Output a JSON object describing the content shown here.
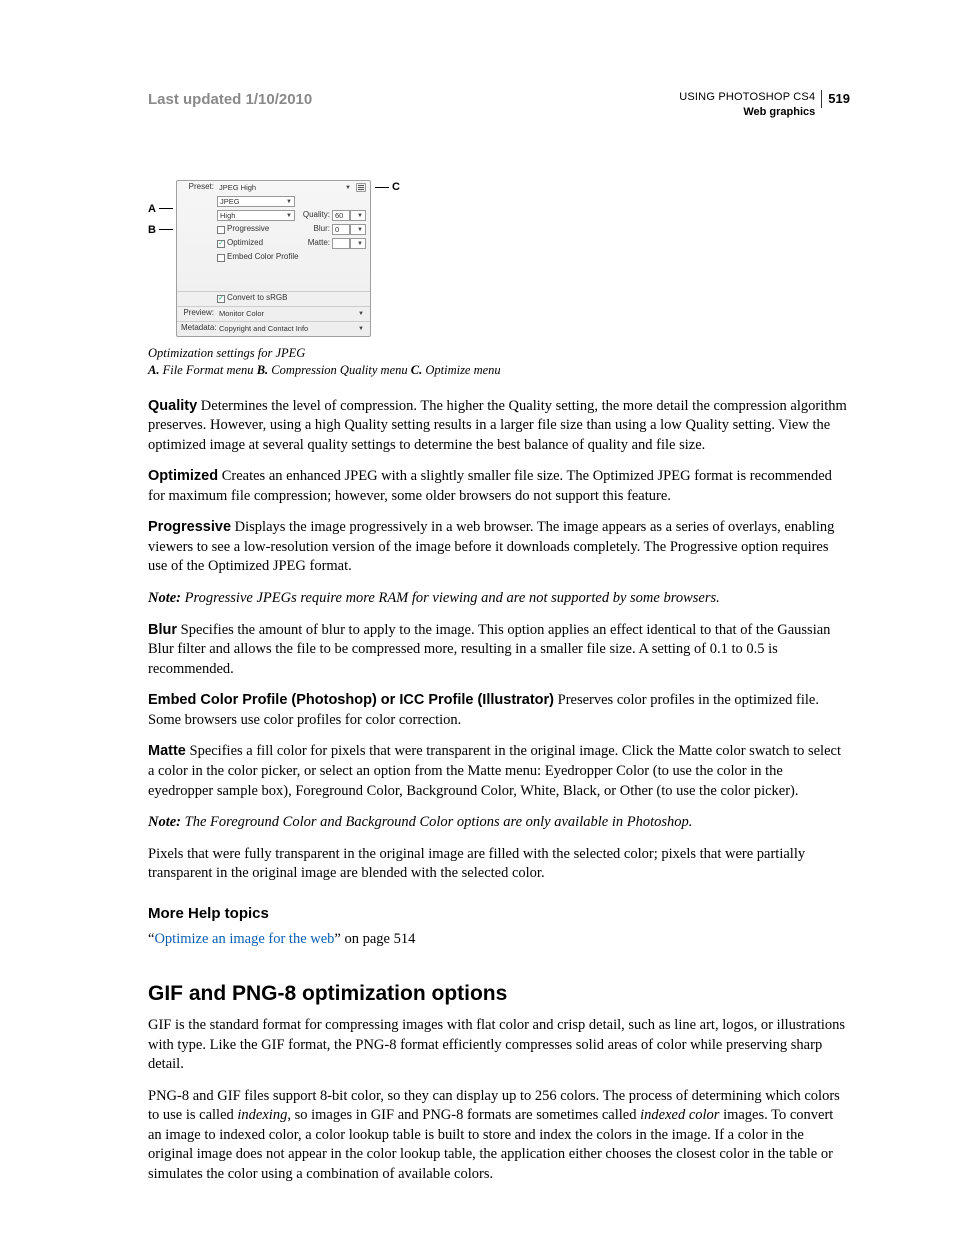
{
  "header": {
    "last_updated": "Last updated 1/10/2010",
    "book_title": "USING PHOTOSHOP CS4",
    "section": "Web graphics",
    "page_number": "519"
  },
  "figure": {
    "callouts": {
      "A": "A",
      "B": "B",
      "C": "C"
    },
    "panel": {
      "preset_label": "Preset:",
      "preset_value": "JPEG High",
      "format_value": "JPEG",
      "quality_preset_value": "High",
      "quality_label": "Quality:",
      "quality_value": "60",
      "progressive_label": "Progressive",
      "blur_label": "Blur:",
      "blur_value": "0",
      "optimized_label": "Optimized",
      "matte_label": "Matte:",
      "embed_label": "Embed Color Profile",
      "convert_label": "Convert to sRGB",
      "preview_label": "Preview:",
      "preview_value": "Monitor Color",
      "metadata_label": "Metadata:",
      "metadata_value": "Copyright and Contact Info"
    },
    "caption_line1": "Optimization settings for JPEG",
    "caption_A_key": "A.",
    "caption_A_text": " File Format menu  ",
    "caption_B_key": "B.",
    "caption_B_text": " Compression Quality menu  ",
    "caption_C_key": "C.",
    "caption_C_text": " Optimize menu "
  },
  "paragraphs": {
    "quality_term": "Quality",
    "quality_body": "  Determines the level of compression. The higher the Quality setting, the more detail the compression algorithm preserves. However, using a high Quality setting results in a larger file size than using a low Quality setting. View the optimized image at several quality settings to determine the best balance of quality and file size.",
    "optimized_term": "Optimized",
    "optimized_body": "  Creates an enhanced JPEG with a slightly smaller file size. The Optimized JPEG format is recommended for maximum file compression; however, some older browsers do not support this feature.",
    "progressive_term": "Progressive",
    "progressive_body": "  Displays the image progressively in a web browser. The image appears as a series of overlays, enabling viewers to see a low-resolution version of the image before it downloads completely. The Progressive option requires use of the Optimized JPEG format.",
    "note1_lead": "Note: ",
    "note1_body": "Progressive JPEGs require more RAM for viewing and are not supported by some browsers.",
    "blur_term": "Blur",
    "blur_body": "  Specifies the amount of blur to apply to the image. This option applies an effect identical to that of the Gaussian Blur filter and allows the file to be compressed more, resulting in a smaller file size. A setting of 0.1 to 0.5 is recommended.",
    "embed_term": "Embed Color Profile (Photoshop) or ICC Profile (Illustrator)",
    "embed_body": "  Preserves color profiles in the optimized file. Some browsers use color profiles for color correction.",
    "matte_term": "Matte",
    "matte_body": "  Specifies a fill color for pixels that were transparent in the original image. Click the Matte color swatch to select a color in the color picker, or select an option from the Matte menu: Eyedropper Color (to use the color in the eyedropper sample box), Foreground Color, Background Color, White, Black, or Other (to use the color picker).",
    "note2_lead": "Note: ",
    "note2_body": "The Foreground Color and Background Color options are only available in Photoshop.",
    "matte_extra": "Pixels that were fully transparent in the original image are filled with the selected color; pixels that were partially transparent in the original image are blended with the selected color."
  },
  "more_help": {
    "heading": "More Help topics",
    "quote_open": "“",
    "link_text": "Optimize an image for the web",
    "quote_close_and_page": "” on page 514"
  },
  "gif_section": {
    "heading": "GIF and PNG-8 optimization options",
    "p1": "GIF is the standard format for compressing images with flat color and crisp detail, such as line art, logos, or illustrations with type. Like the GIF format, the PNG-8 format efficiently compresses solid areas of color while preserving sharp detail.",
    "p2_a": "PNG-8 and GIF files support 8-bit color, so they can display up to 256 colors. The process of determining which colors to use is called ",
    "p2_i1": "indexing",
    "p2_b": ", so images in GIF and PNG-8 formats are sometimes called ",
    "p2_i2": "indexed color",
    "p2_c": " images. To convert an image to indexed color, a color lookup table is built to store and index the colors in the image. If a color in the original image does not appear in the color lookup table, the application either chooses the closest color in the table or simulates the color using a combination of available colors."
  }
}
